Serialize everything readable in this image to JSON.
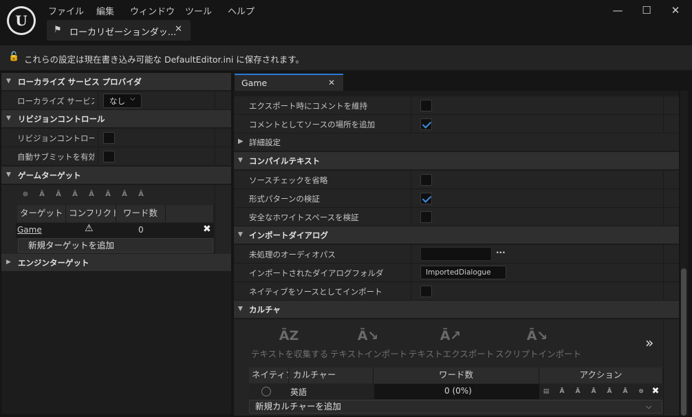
{
  "app": {
    "menu": [
      "ファイル",
      "編集",
      "ウィンドウ",
      "ツール",
      "ヘルプ"
    ],
    "tab_title": "ローカリゼーションダッ...",
    "info_text": "これらの設定は現在書き込み可能な DefaultEditor.ini に保存されます。"
  },
  "left": {
    "sec_service": "ローカライズ サービス プロバイダ",
    "service_label": "ローカライズ サービス",
    "service_value": "なし",
    "sec_revision": "リビジョンコントロール",
    "revision_label": "リビジョンコントロール:",
    "autosubmit_label": "自動サブミットを有効化",
    "sec_game": "ゲームターゲット",
    "tool_icons": [
      "gather-text-icon",
      "import-text-icon",
      "export-text-icon",
      "import-dialogue-script-icon",
      "export-dialogue-script-icon",
      "import-dialogue-icon",
      "count-words-icon",
      "compile-text-icon"
    ],
    "columns": [
      "ターゲット",
      "コンフリクト",
      "ワード数"
    ],
    "target_name": "Game",
    "target_words": "0",
    "add_target": "新規ターゲットを追加",
    "sec_engine": "エンジンターゲット"
  },
  "right": {
    "tab": "Game",
    "export_comment": "エクスポート時にコメントを維持",
    "add_source_loc": "コメントとしてソースの場所を追加",
    "advanced": "詳細設定",
    "sec_compile": "コンパイルテキスト",
    "skip_source_check": "ソースチェックを省略",
    "validate_format": "形式パターンの検証",
    "validate_whitespace": "安全なホワイトスペースを検証",
    "sec_import_dialog": "インポートダイアログ",
    "raw_audio_path": "未処理のオーディオパス",
    "imported_folder": "インポートされたダイアログフォルダ",
    "imported_folder_value": "ImportedDialogue",
    "import_native": "ネイティブをソースとしてインポート",
    "sec_culture": "カルチャ",
    "tools": [
      {
        "label": "テキストを収集する",
        "icon": "gather-text-icon"
      },
      {
        "label": "テキストインポート",
        "icon": "import-text-icon"
      },
      {
        "label": "テキストエクスポート",
        "icon": "export-text-icon"
      },
      {
        "label": "スクリプトインポート",
        "icon": "import-script-icon"
      }
    ],
    "culture_columns": [
      "ネイティブ",
      "カルチャー",
      "ワード数",
      "アクション"
    ],
    "culture_name": "英語",
    "culture_words": "0 (0%)",
    "add_culture": "新規カルチャーを追加"
  }
}
